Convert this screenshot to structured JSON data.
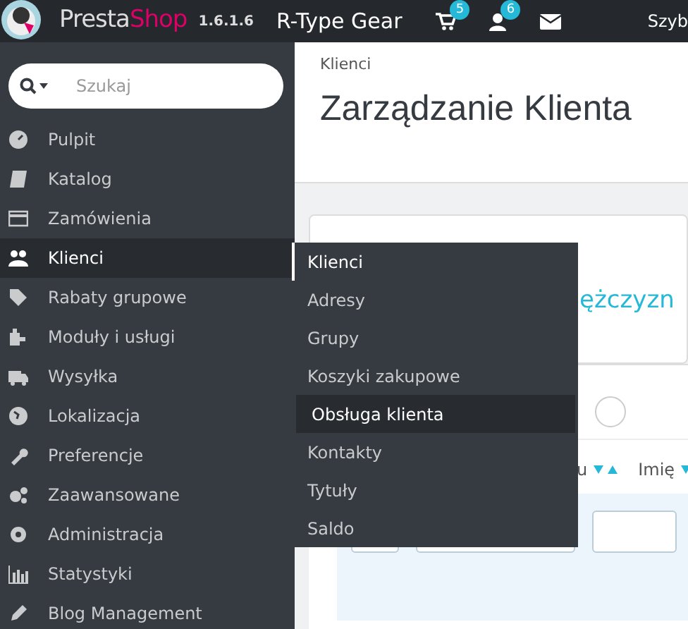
{
  "topbar": {
    "logo_parts": [
      "Presta",
      "Shop"
    ],
    "version": "1.6.1.6",
    "shop_name": "R-Type Gear",
    "cart_badge": "5",
    "customers_badge": "6",
    "quick_access": "Szyb"
  },
  "sidebar": {
    "search": {
      "placeholder": "Szukaj"
    },
    "items": [
      {
        "label": "Pulpit",
        "selected": false
      },
      {
        "label": "Katalog",
        "selected": false
      },
      {
        "label": "Zamówienia",
        "selected": false
      },
      {
        "label": "Klienci",
        "selected": true
      },
      {
        "label": "Rabaty grupowe",
        "selected": false
      },
      {
        "label": "Moduły i usługi",
        "selected": false
      },
      {
        "label": "Wysyłka",
        "selected": false
      },
      {
        "label": "Lokalizacja",
        "selected": false
      },
      {
        "label": "Preferencje",
        "selected": false
      },
      {
        "label": "Zaawansowane",
        "selected": false
      },
      {
        "label": "Administracja",
        "selected": false
      },
      {
        "label": "Statystyki",
        "selected": false
      },
      {
        "label": "Blog Management",
        "selected": false
      }
    ]
  },
  "submenu": {
    "items": [
      {
        "label": "Klienci",
        "selected": true,
        "hovered": false
      },
      {
        "label": "Adresy",
        "selected": false,
        "hovered": false
      },
      {
        "label": "Grupy",
        "selected": false,
        "hovered": false
      },
      {
        "label": "Koszyki zakupowe",
        "selected": false,
        "hovered": false
      },
      {
        "label": "Obsługa klienta",
        "selected": false,
        "hovered": true
      },
      {
        "label": "Kontakty",
        "selected": false,
        "hovered": false
      },
      {
        "label": "Tytuły",
        "selected": false,
        "hovered": false
      },
      {
        "label": "Saldo",
        "selected": false,
        "hovered": false
      }
    ]
  },
  "page": {
    "breadcrumb": "Klienci",
    "title": "Zarządzanie Klienta",
    "stat_label": "ężczyzn",
    "radio": {
      "checked": false
    },
    "table": {
      "columns": [
        "u",
        "Imię"
      ]
    }
  }
}
